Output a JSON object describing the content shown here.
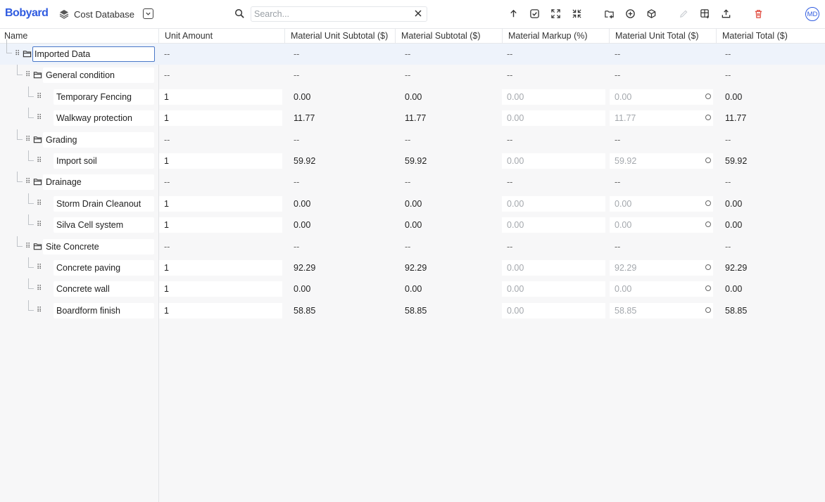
{
  "app": {
    "logo": "Bobyard",
    "database_name": "Cost Database"
  },
  "search": {
    "placeholder": "Search..."
  },
  "columns": {
    "name": "Name",
    "unit_amount": "Unit Amount",
    "mat_unit_subtotal": "Material Unit Subtotal ($)",
    "mat_subtotal": "Material Subtotal ($)",
    "mat_markup": "Material Markup (%)",
    "mat_unit_total": "Material Unit Total ($)",
    "mat_total": "Material Total ($)"
  },
  "user": {
    "initials": "MD"
  },
  "colors": {
    "brand": "#2f5be0",
    "delete": "#e0463a",
    "selected_row": "#eef3fb"
  },
  "rows": [
    {
      "name": "Imported Data",
      "unit": "--",
      "mus": "--",
      "ms": "--",
      "mm": "--",
      "mut": "--",
      "mt": "--"
    },
    {
      "name": "General condition",
      "unit": "--",
      "mus": "--",
      "ms": "--",
      "mm": "--",
      "mut": "--",
      "mt": "--"
    },
    {
      "name": "Temporary Fencing",
      "unit": "1",
      "mus": "0.00",
      "ms": "0.00",
      "mm": "0.00",
      "mut": "0.00",
      "mt": "0.00"
    },
    {
      "name": "Walkway protection",
      "unit": "1",
      "mus": "11.77",
      "ms": "11.77",
      "mm": "0.00",
      "mut": "11.77",
      "mt": "11.77"
    },
    {
      "name": "Grading",
      "unit": "--",
      "mus": "--",
      "ms": "--",
      "mm": "--",
      "mut": "--",
      "mt": "--"
    },
    {
      "name": "Import soil",
      "unit": "1",
      "mus": "59.92",
      "ms": "59.92",
      "mm": "0.00",
      "mut": "59.92",
      "mt": "59.92"
    },
    {
      "name": "Drainage",
      "unit": "--",
      "mus": "--",
      "ms": "--",
      "mm": "--",
      "mut": "--",
      "mt": "--"
    },
    {
      "name": "Storm Drain Cleanout",
      "unit": "1",
      "mus": "0.00",
      "ms": "0.00",
      "mm": "0.00",
      "mut": "0.00",
      "mt": "0.00"
    },
    {
      "name": "Silva Cell system",
      "unit": "1",
      "mus": "0.00",
      "ms": "0.00",
      "mm": "0.00",
      "mut": "0.00",
      "mt": "0.00"
    },
    {
      "name": "Site Concrete",
      "unit": "--",
      "mus": "--",
      "ms": "--",
      "mm": "--",
      "mut": "--",
      "mt": "--"
    },
    {
      "name": "Concrete paving",
      "unit": "1",
      "mus": "92.29",
      "ms": "92.29",
      "mm": "0.00",
      "mut": "92.29",
      "mt": "92.29"
    },
    {
      "name": "Concrete wall",
      "unit": "1",
      "mus": "0.00",
      "ms": "0.00",
      "mm": "0.00",
      "mut": "0.00",
      "mt": "0.00"
    },
    {
      "name": "Boardform finish",
      "unit": "1",
      "mus": "58.85",
      "ms": "58.85",
      "mm": "0.00",
      "mut": "58.85",
      "mt": "58.85"
    }
  ]
}
